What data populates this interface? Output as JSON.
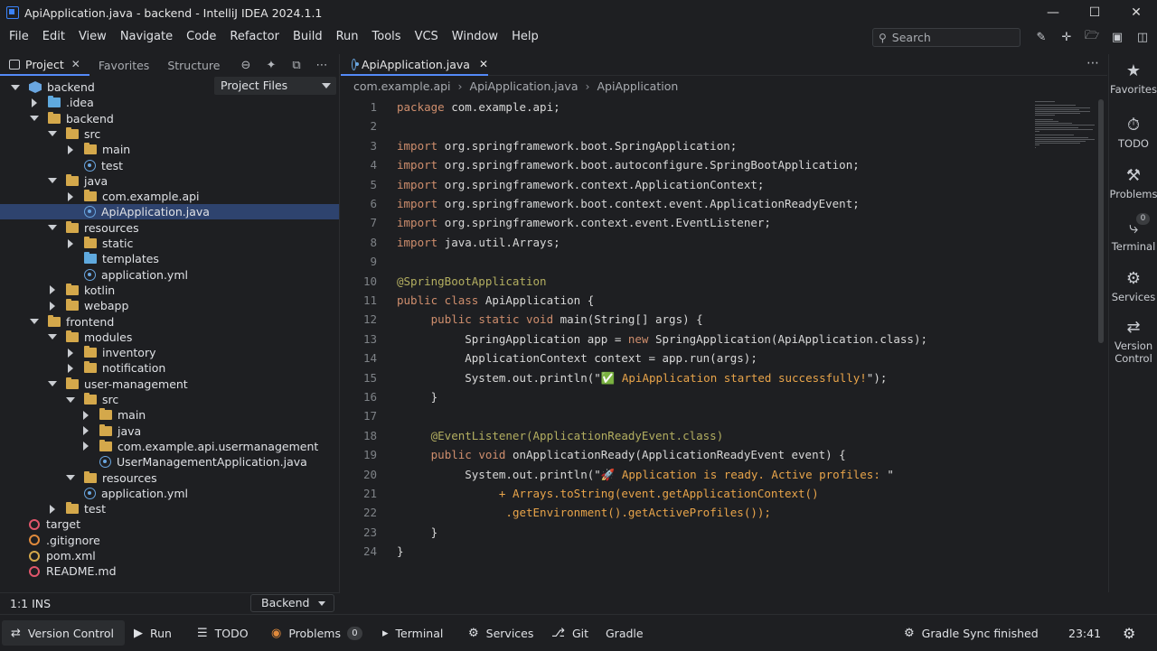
{
  "window": {
    "title": "ApiApplication.java - backend - IntelliJ IDEA 2024.1.1"
  },
  "menu": [
    "File",
    "Edit",
    "View",
    "Navigate",
    "Code",
    "Refactor",
    "Build",
    "Run",
    "Tools",
    "VCS",
    "Window",
    "Help"
  ],
  "search": {
    "placeholder": "Search"
  },
  "left_panel": {
    "tabs": [
      "Project",
      "Favorites",
      "Structure"
    ],
    "view_selector": "Project Files",
    "tree": [
      {
        "label": "backend",
        "depth": 0,
        "twisty": "open",
        "icon": "module-icon"
      },
      {
        "label": ".idea",
        "depth": 1,
        "twisty": "closed",
        "icon": "folder-blue-icon"
      },
      {
        "label": "backend",
        "depth": 1,
        "twisty": "open",
        "icon": "folder-icon"
      },
      {
        "label": "src",
        "depth": 2,
        "twisty": "open",
        "icon": "folder-icon"
      },
      {
        "label": "main",
        "depth": 3,
        "twisty": "closed",
        "icon": "folder-icon"
      },
      {
        "label": "test",
        "depth": 3,
        "twisty": "none",
        "icon": "java-file-icon"
      },
      {
        "label": "java",
        "depth": 2,
        "twisty": "open",
        "icon": "folder-icon"
      },
      {
        "label": "com.example.api",
        "depth": 3,
        "twisty": "closed",
        "icon": "folder-icon"
      },
      {
        "label": "ApiApplication.java",
        "depth": 3,
        "twisty": "none",
        "icon": "java-file-icon",
        "selected": true
      },
      {
        "label": "resources",
        "depth": 2,
        "twisty": "open",
        "icon": "folder-icon"
      },
      {
        "label": "static",
        "depth": 3,
        "twisty": "closed",
        "icon": "folder-icon"
      },
      {
        "label": "templates",
        "depth": 3,
        "twisty": "none",
        "icon": "folder-blue-icon"
      },
      {
        "label": "application.yml",
        "depth": 3,
        "twisty": "none",
        "icon": "java-file-icon"
      },
      {
        "label": "kotlin",
        "depth": 2,
        "twisty": "closed",
        "icon": "folder-icon"
      },
      {
        "label": "webapp",
        "depth": 2,
        "twisty": "closed",
        "icon": "folder-icon"
      },
      {
        "label": "frontend",
        "depth": 1,
        "twisty": "open",
        "icon": "folder-icon"
      },
      {
        "label": "modules",
        "depth": 2,
        "twisty": "open",
        "icon": "folder-icon"
      },
      {
        "label": "inventory",
        "depth": 3,
        "twisty": "closed",
        "icon": "folder-icon"
      },
      {
        "label": "notification",
        "depth": 3,
        "twisty": "closed",
        "icon": "folder-icon"
      },
      {
        "label": "user-management",
        "depth": 2,
        "twisty": "open",
        "icon": "folder-icon"
      },
      {
        "label": "src",
        "depth": 3,
        "twisty": "open",
        "icon": "folder-icon"
      },
      {
        "label": "main",
        "depth": 4,
        "twisty": "closed",
        "icon": "folder-icon"
      },
      {
        "label": "java",
        "depth": 4,
        "twisty": "closed",
        "icon": "folder-icon"
      },
      {
        "label": "com.example.api.usermanagement",
        "depth": 4,
        "twisty": "closed",
        "icon": "folder-icon"
      },
      {
        "label": "UserManagementApplication.java",
        "depth": 4,
        "twisty": "none",
        "icon": "java-file-icon"
      },
      {
        "label": "resources",
        "depth": 3,
        "twisty": "open",
        "icon": "folder-icon"
      },
      {
        "label": "application.yml",
        "depth": 3,
        "twisty": "none",
        "icon": "java-file-icon"
      },
      {
        "label": "test",
        "depth": 2,
        "twisty": "closed",
        "icon": "folder-icon"
      },
      {
        "label": "target",
        "depth": 0,
        "twisty": "none",
        "icon": "target-icon"
      },
      {
        "label": ".gitignore",
        "depth": 0,
        "twisty": "none",
        "icon": "gitignore-icon"
      },
      {
        "label": "pom.xml",
        "depth": 0,
        "twisty": "none",
        "icon": "maven-icon"
      },
      {
        "label": "README.md",
        "depth": 0,
        "twisty": "none",
        "icon": "markdown-icon"
      }
    ],
    "status": {
      "caret": "1:1 INS",
      "config": "Backend"
    }
  },
  "editor": {
    "tab": "ApiApplication.java",
    "breadcrumbs": [
      "com.example.api",
      "ApiApplication.java",
      "ApiApplication"
    ],
    "lines": [
      [
        {
          "t": "package ",
          "c": "kw"
        },
        {
          "t": "com.example.api;"
        }
      ],
      [],
      [
        {
          "t": "import ",
          "c": "kw"
        },
        {
          "t": "org.springframework.boot.SpringApplication;"
        }
      ],
      [
        {
          "t": "import ",
          "c": "kw"
        },
        {
          "t": "org.springframework.boot.autoconfigure.SpringBootApplication;"
        }
      ],
      [
        {
          "t": "import ",
          "c": "kw"
        },
        {
          "t": "org.springframework.context.ApplicationContext;"
        }
      ],
      [
        {
          "t": "import ",
          "c": "kw"
        },
        {
          "t": "org.springframework.boot.context.event.ApplicationReadyEvent;"
        }
      ],
      [
        {
          "t": "import ",
          "c": "kw"
        },
        {
          "t": "org.springframework.context.event.EventListener;"
        }
      ],
      [
        {
          "t": "import ",
          "c": "kw"
        },
        {
          "t": "java.util.Arrays;"
        }
      ],
      [],
      [
        {
          "t": "@SpringBootApplication",
          "c": "an"
        }
      ],
      [
        {
          "t": "public class ",
          "c": "kw"
        },
        {
          "t": "ApiApplication {"
        }
      ],
      [
        {
          "t": "     "
        },
        {
          "t": "public static void ",
          "c": "kw"
        },
        {
          "t": "main(String[] args) {"
        }
      ],
      [
        {
          "t": "          SpringApplication app = "
        },
        {
          "t": "new ",
          "c": "kw"
        },
        {
          "t": "SpringApplication(ApiApplication.class);"
        }
      ],
      [
        {
          "t": "          ApplicationContext context = app.run(args);"
        }
      ],
      [
        {
          "t": "          System.out.println(\""
        },
        {
          "t": "✅ ApiApplication started successfully!",
          "c": "str"
        },
        {
          "t": "\");"
        }
      ],
      [
        {
          "t": "     }"
        }
      ],
      [],
      [
        {
          "t": "     @EventListener(ApplicationReadyEvent.class)",
          "c": "an"
        }
      ],
      [
        {
          "t": "     "
        },
        {
          "t": "public void ",
          "c": "kw"
        },
        {
          "t": "onApplicationReady(ApplicationReadyEvent event) {"
        }
      ],
      [
        {
          "t": "          System.out.println(\""
        },
        {
          "t": "🚀 Application is ready. Active profiles: ",
          "c": "str"
        },
        {
          "t": "\""
        }
      ],
      [
        {
          "t": "               "
        },
        {
          "t": "+ Arrays.toString(event.getApplicationContext()",
          "c": "str"
        }
      ],
      [
        {
          "t": "                "
        },
        {
          "t": ".getEnvironment().getActiveProfiles());",
          "c": "str"
        }
      ],
      [
        {
          "t": "     }"
        }
      ],
      [
        {
          "t": "}"
        }
      ]
    ]
  },
  "right_bar": [
    {
      "label": "Favorites",
      "icon": "star-icon"
    },
    {
      "label": "TODO",
      "icon": "clock-icon"
    },
    {
      "label": "Problems",
      "icon": "wrench-icon"
    },
    {
      "label": "Terminal",
      "icon": "terminal-icon",
      "badge": "0"
    },
    {
      "label": "Services",
      "icon": "services-icon"
    },
    {
      "label": "Version\nControl",
      "icon": "vcs-icon"
    }
  ],
  "status_bar": {
    "items": [
      {
        "label": "Version Control",
        "icon": "vcs-icon",
        "active": true
      },
      {
        "label": "Run",
        "icon": "run-icon"
      },
      {
        "label": "TODO",
        "icon": "todo-icon"
      },
      {
        "label": "Problems",
        "icon": "problems-icon",
        "badge": "0"
      },
      {
        "label": "Terminal",
        "icon": "terminal-icon"
      },
      {
        "label": "Services",
        "icon": "services-icon"
      },
      {
        "label": "Git",
        "icon": "git-icon"
      },
      {
        "label": "Gradle",
        "icon": "gradle-icon"
      }
    ],
    "sync": "Gradle Sync finished",
    "time": "23:41"
  }
}
